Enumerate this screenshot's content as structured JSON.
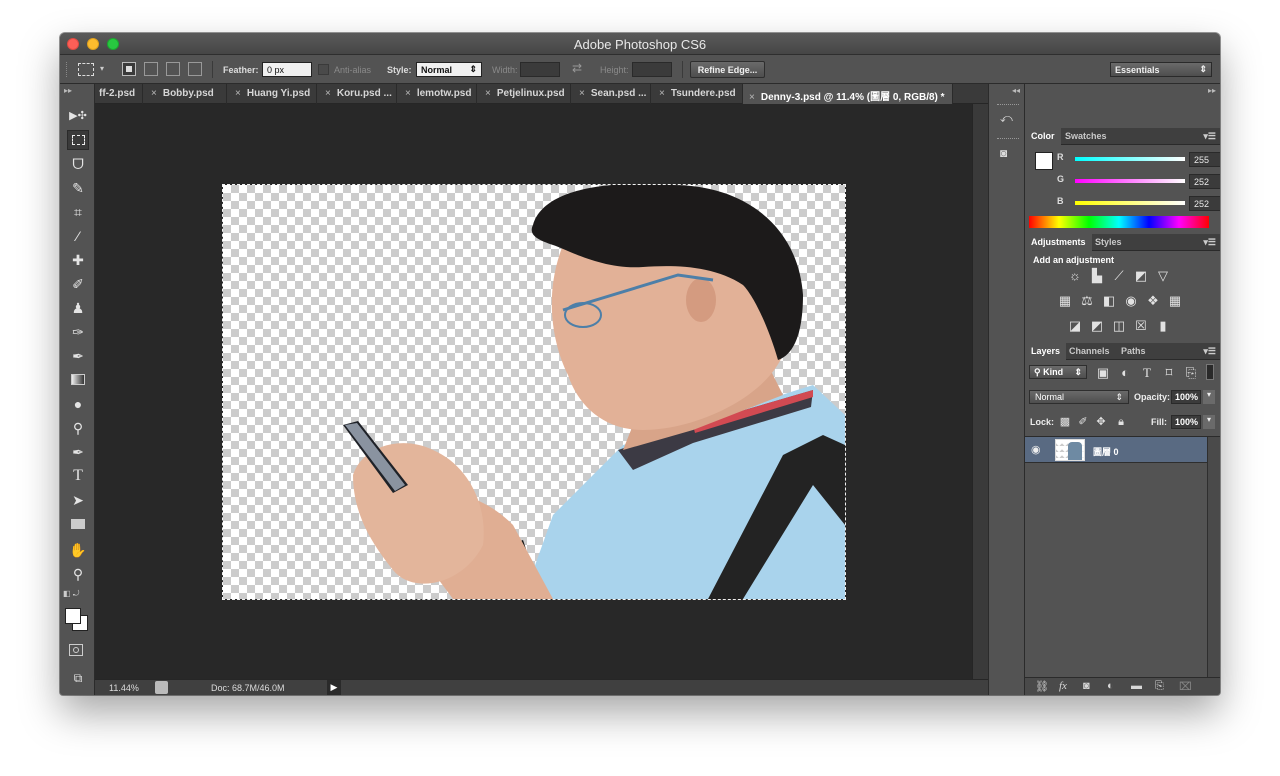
{
  "window": {
    "title": "Adobe Photoshop CS6"
  },
  "options_bar": {
    "feather_label": "Feather:",
    "feather_value": "0 px",
    "antialias_label": "Anti-alias",
    "style_label": "Style:",
    "style_value": "Normal",
    "width_label": "Width:",
    "height_label": "Height:",
    "refine_edge_label": "Refine Edge...",
    "workspace_value": "Essentials"
  },
  "tabs": [
    {
      "label": "ff-2.psd"
    },
    {
      "label": "Bobby.psd"
    },
    {
      "label": "Huang Yi.psd"
    },
    {
      "label": "Koru.psd ..."
    },
    {
      "label": "lemotw.psd"
    },
    {
      "label": "Petjelinux.psd"
    },
    {
      "label": "Sean.psd ..."
    },
    {
      "label": "Tsundere.psd"
    },
    {
      "label": "Denny-3.psd @ 11.4% (圖層 0, RGB/8) *"
    }
  ],
  "tabs_overflow": ">>",
  "status_bar": {
    "zoom": "11.44%",
    "doc": "Doc: 68.7M/46.0M"
  },
  "color_panel": {
    "tabs": [
      "Color",
      "Swatches"
    ],
    "r_label": "R",
    "r_value": "255",
    "g_label": "G",
    "g_value": "252",
    "b_label": "B",
    "b_value": "252"
  },
  "adjustments_panel": {
    "tabs": [
      "Adjustments",
      "Styles"
    ],
    "heading": "Add an adjustment"
  },
  "layers_panel": {
    "tabs": [
      "Layers",
      "Channels",
      "Paths"
    ],
    "filter_kind": "Kind",
    "blend_mode": "Normal",
    "opacity_label": "Opacity:",
    "opacity_value": "100%",
    "lock_label": "Lock:",
    "fill_label": "Fill:",
    "fill_value": "100%",
    "layer_name": "圖層 0"
  },
  "colors": {
    "active_layer": "#596a82",
    "panel_bg": "#535353",
    "canvas_area": "#282828"
  }
}
